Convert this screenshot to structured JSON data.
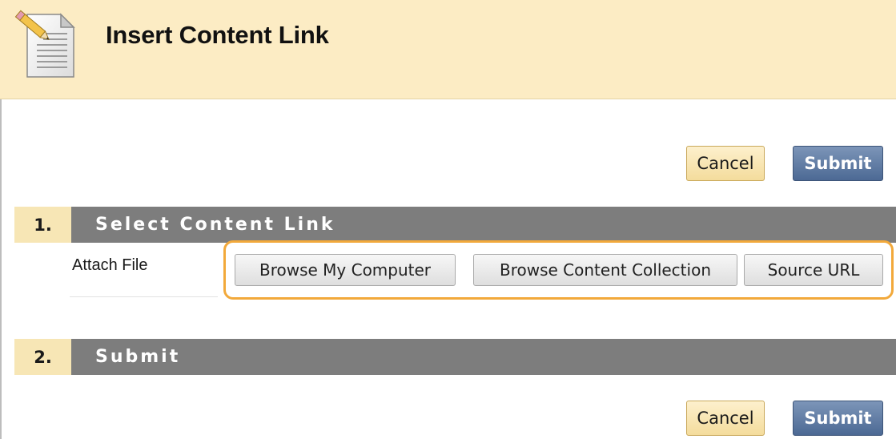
{
  "header": {
    "title": "Insert Content Link",
    "icon": "document-pencil-icon"
  },
  "actions": {
    "cancel_label": "Cancel",
    "submit_label": "Submit"
  },
  "steps": [
    {
      "number": "1.",
      "title": "Select Content Link",
      "fields": [
        {
          "label": "Attach File",
          "buttons": [
            "Browse My Computer",
            "Browse Content Collection",
            "Source URL"
          ]
        }
      ]
    },
    {
      "number": "2.",
      "title": "Submit"
    }
  ],
  "colors": {
    "header_bg": "#fcecc4",
    "step_bar": "#7d7d7d",
    "step_number_bg": "#f7e6b5",
    "submit_bg": "#5a76a0",
    "cancel_bg": "#f8e4ad",
    "highlight": "#f2a93b"
  }
}
